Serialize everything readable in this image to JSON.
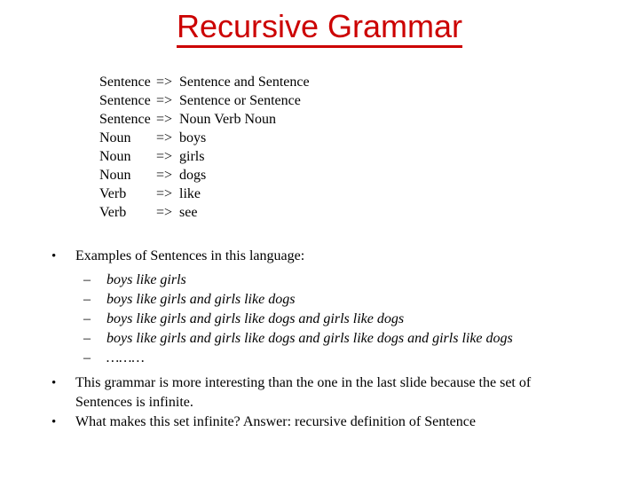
{
  "slide": {
    "title": "Recursive Grammar",
    "title_color": "#cc0000",
    "background_color": "#ffffff"
  },
  "grammar": {
    "arrow": "=>",
    "rules": [
      {
        "lhs": "Sentence",
        "arrow": "=>",
        "rhs": "Sentence and Sentence"
      },
      {
        "lhs": "Sentence",
        "arrow": "=>",
        "rhs": "Sentence or Sentence"
      },
      {
        "lhs": "Sentence",
        "arrow": "=>",
        "rhs": "Noun Verb Noun"
      },
      {
        "lhs": "Noun",
        "arrow": "=>",
        "rhs": "boys"
      },
      {
        "lhs": "Noun",
        "arrow": "=>",
        "rhs": "girls"
      },
      {
        "lhs": "Noun",
        "arrow": "=>",
        "rhs": "dogs"
      },
      {
        "lhs": "Verb",
        "arrow": "=>",
        "rhs": "like"
      },
      {
        "lhs": "Verb",
        "arrow": "=>",
        "rhs": "see"
      }
    ]
  },
  "body": {
    "bullet_marker": "•",
    "sub_marker": "–",
    "bullets": [
      {
        "text": "Examples of Sentences in this language:"
      },
      {
        "text": "This grammar is more interesting than the one in the last slide because the set of Sentences is infinite."
      },
      {
        "text": "What makes this set infinite? Answer: recursive definition of Sentence"
      }
    ],
    "examples": [
      {
        "text": "boys like girls"
      },
      {
        "text": "boys like girls and girls like dogs"
      },
      {
        "text": "boys like girls and girls like dogs and girls like dogs"
      },
      {
        "text": "boys like girls and girls like dogs and girls like dogs and girls like dogs"
      },
      {
        "text": "………"
      }
    ]
  }
}
